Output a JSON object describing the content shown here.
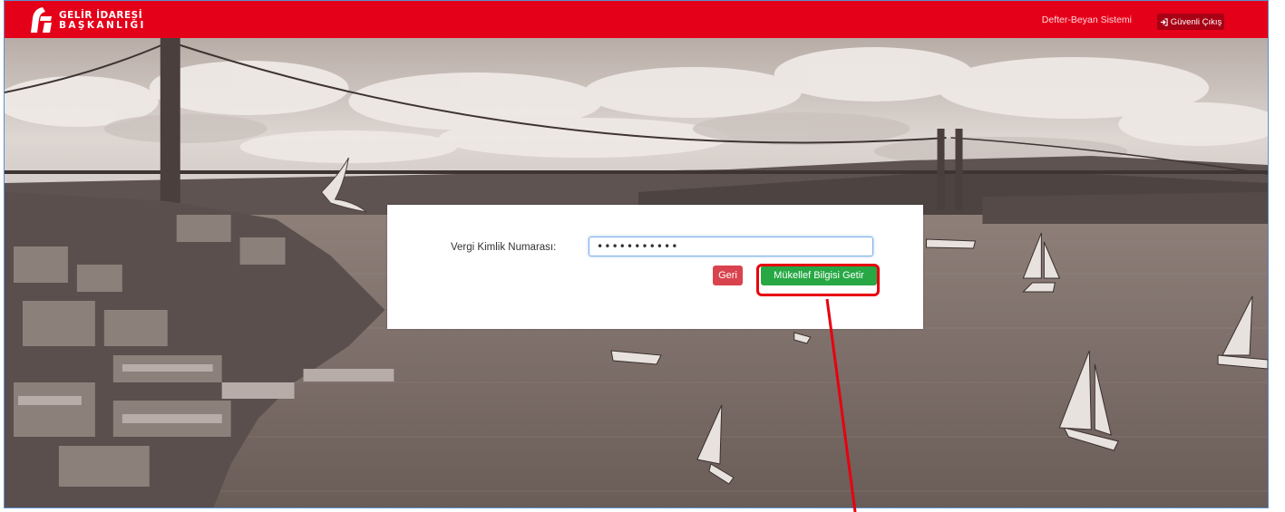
{
  "header": {
    "logo_line1": "GELİR İDARESİ",
    "logo_line2": "BAŞKANLIĞI",
    "system_title": "Defter-Beyan Sistemi",
    "logout_label": "Güvenli Çıkış",
    "logout_icon": "sign-out-icon",
    "bar_color": "#e5001a"
  },
  "form": {
    "vkn_label": "Vergi Kimlik Numarası:",
    "vkn_value": "•••••••••••",
    "back_label": "Geri",
    "fetch_label": "Mükellef Bilgisi Getir"
  },
  "colors": {
    "back_button": "#d9434e",
    "fetch_button": "#27a844",
    "annotation": "#e8000f"
  }
}
